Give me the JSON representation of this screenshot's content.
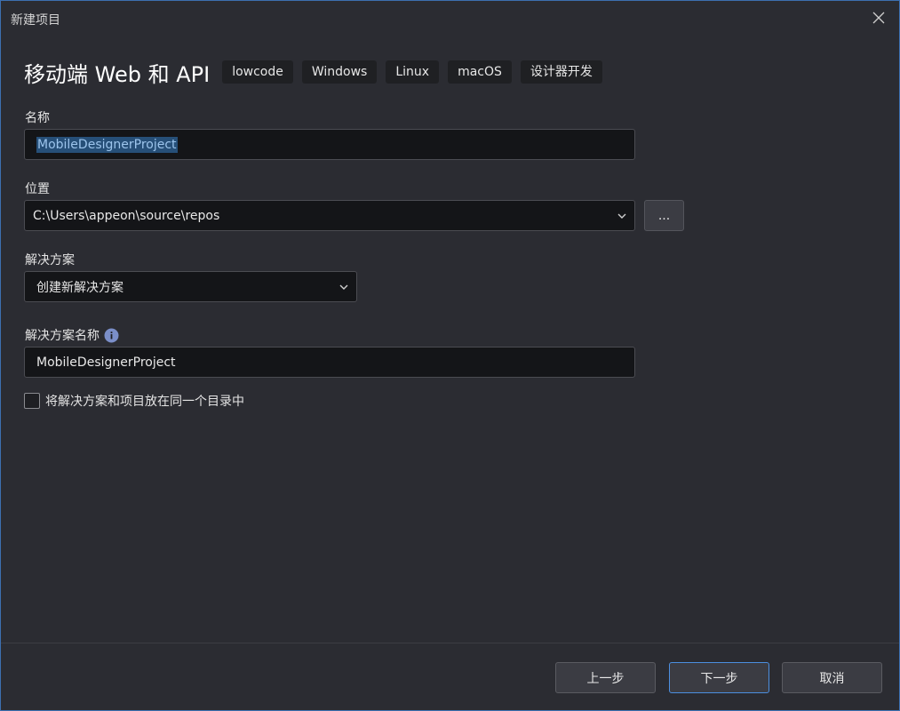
{
  "window": {
    "title": "新建项目",
    "close_icon": "close-icon"
  },
  "header": {
    "template_name": "移动端 Web 和 API",
    "tags": [
      "lowcode",
      "Windows",
      "Linux",
      "macOS",
      "设计器开发"
    ]
  },
  "form": {
    "name_label": "名称",
    "name_value": "MobileDesignerProject",
    "location_label": "位置",
    "location_value": "C:\\Users\\appeon\\source\\repos",
    "browse_label": "...",
    "solution_label": "解决方案",
    "solution_value": "创建新解决方案",
    "solution_name_label": "解决方案名称",
    "solution_name_value": "MobileDesignerProject",
    "same_dir_label": "将解决方案和项目放在同一个目录中",
    "same_dir_checked": false
  },
  "footer": {
    "back_label": "上一步",
    "next_label": "下一步",
    "cancel_label": "取消"
  },
  "colors": {
    "accent": "#4c8fe0",
    "selection": "#264f78",
    "background": "#2b2c32"
  }
}
